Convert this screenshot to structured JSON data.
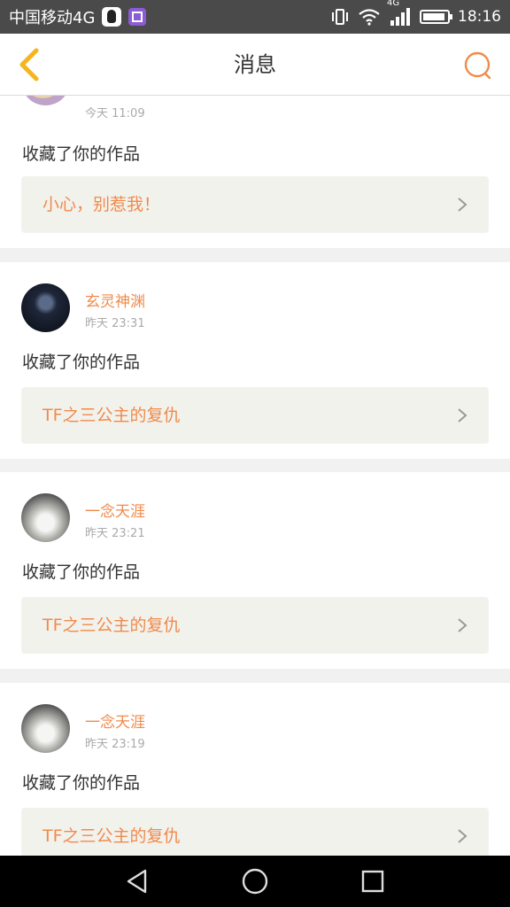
{
  "status_bar": {
    "carrier": "中国移动4G",
    "network": "4G",
    "time": "18:16"
  },
  "header": {
    "title": "消息"
  },
  "colors": {
    "accent": "#f08a4b",
    "back_arrow": "#f5b51b",
    "work_bg": "#f2f2ed"
  },
  "icons": [
    "back-icon",
    "search-icon",
    "qq-icon",
    "gallery-icon",
    "vibrate-icon",
    "wifi-icon",
    "signal-icon",
    "battery-icon",
    "chevron-right-icon",
    "nav-back-icon",
    "nav-home-icon",
    "nav-recents-icon"
  ],
  "messages": [
    {
      "user": "",
      "time": "今天 11:09",
      "action": "收藏了你的作品",
      "work": "小心，别惹我！"
    },
    {
      "user": "玄灵神渊",
      "time": "昨天 23:31",
      "action": "收藏了你的作品",
      "work": "TF之三公主的复仇"
    },
    {
      "user": "一念天涯",
      "time": "昨天 23:21",
      "action": "收藏了你的作品",
      "work": "TF之三公主的复仇"
    },
    {
      "user": "一念天涯",
      "time": "昨天 23:19",
      "action": "收藏了你的作品",
      "work": "TF之三公主的复仇"
    }
  ]
}
